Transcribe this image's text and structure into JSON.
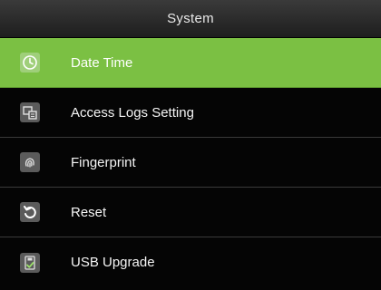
{
  "header": {
    "title": "System"
  },
  "menu": {
    "items": [
      {
        "label": "Date Time",
        "icon": "clock-icon",
        "selected": true
      },
      {
        "label": "Access Logs Setting",
        "icon": "logs-icon",
        "selected": false
      },
      {
        "label": "Fingerprint",
        "icon": "fingerprint-icon",
        "selected": false
      },
      {
        "label": "Reset",
        "icon": "reset-icon",
        "selected": false
      },
      {
        "label": "USB Upgrade",
        "icon": "usb-upgrade-icon",
        "selected": false
      }
    ]
  },
  "colors": {
    "selected_background": "#7bc043",
    "background": "#050505",
    "divider": "#3a3a3a"
  }
}
